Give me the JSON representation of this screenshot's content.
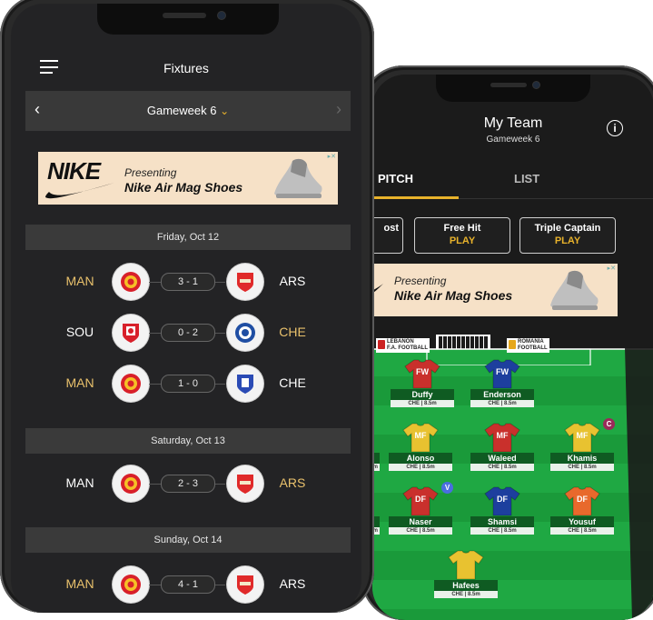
{
  "colors": {
    "accent": "#e8b22b",
    "background": "#232325",
    "pitch": "#1a9a3a"
  },
  "fixtures_screen": {
    "title": "Fixtures",
    "menu_icon": "hamburger-menu-icon",
    "gameweek_label": "Gameweek 6",
    "prev_icon": "chevron-left-icon",
    "next_icon": "chevron-right-icon",
    "dropdown_icon": "chevron-down-icon",
    "ad": {
      "brand": "NIKE",
      "presenting": "Presenting",
      "product": "Nike Air Mag Shoes"
    },
    "days": [
      {
        "label": "Friday, Oct 12",
        "matches": [
          {
            "home": "MAN",
            "away": "ARS",
            "score": "3 - 1"
          },
          {
            "home": "SOU",
            "away": "CHE",
            "score": "0 - 2"
          },
          {
            "home": "MAN",
            "away": "CHE",
            "score": "1 - 0"
          }
        ]
      },
      {
        "label": "Saturday, Oct 13",
        "matches": [
          {
            "home": "MAN",
            "away": "ARS",
            "score": "2 - 3"
          }
        ]
      },
      {
        "label": "Sunday, Oct 14",
        "matches": [
          {
            "home": "MAN",
            "away": "ARS",
            "score": "4 - 1"
          }
        ]
      }
    ]
  },
  "team_screen": {
    "title": "My Team",
    "subtitle": "Gameweek 6",
    "info_icon": "info-icon",
    "tabs": [
      {
        "label": "PITCH",
        "active": true
      },
      {
        "label": "LIST",
        "active": false
      }
    ],
    "chips": [
      {
        "label": "ost",
        "action": ""
      },
      {
        "label": "Free Hit",
        "action": "PLAY"
      },
      {
        "label": "Triple Captain",
        "action": "PLAY"
      }
    ],
    "ad": {
      "presenting": "Presenting",
      "product": "Nike Air Mag Shoes"
    },
    "boards": [
      {
        "line1": "LEBANON",
        "line2": "F.A. FOOTBALL"
      },
      {
        "line1": "ROMANIA",
        "line2": "FOOTBALL"
      }
    ],
    "players": [
      {
        "pos": "FW",
        "name": "Duffy",
        "info": "CHE | 8.5m",
        "kit": "#c9302c"
      },
      {
        "pos": "FW",
        "name": "Enderson",
        "info": "CHE | 8.5m",
        "kit": "#1d3f9e"
      },
      {
        "pos": "MF",
        "name": "Alonso",
        "info": "CHE | 8.5m",
        "kit": "#e8c230"
      },
      {
        "pos": "MF",
        "name": "Waleed",
        "info": "CHE | 8.5m",
        "kit": "#c9302c"
      },
      {
        "pos": "MF",
        "name": "Khamis",
        "info": "CHE | 8.5m",
        "kit": "#e8c230",
        "badge": "C"
      },
      {
        "pos": "DF",
        "name": "Naser",
        "info": "CHE | 8.5m",
        "kit": "#c9302c",
        "badge": "V"
      },
      {
        "pos": "DF",
        "name": "Shamsi",
        "info": "CHE | 8.5m",
        "kit": "#1d3f9e"
      },
      {
        "pos": "DF",
        "name": "Yousuf",
        "info": "CHE | 8.5m",
        "kit": "#e8692c"
      },
      {
        "pos": "",
        "name": "Hafees",
        "info": "CHE | 8.5m",
        "kit": "#e8c230"
      }
    ],
    "partial_left_players": [
      {
        "info": "5m"
      },
      {
        "info": "5m"
      }
    ]
  }
}
